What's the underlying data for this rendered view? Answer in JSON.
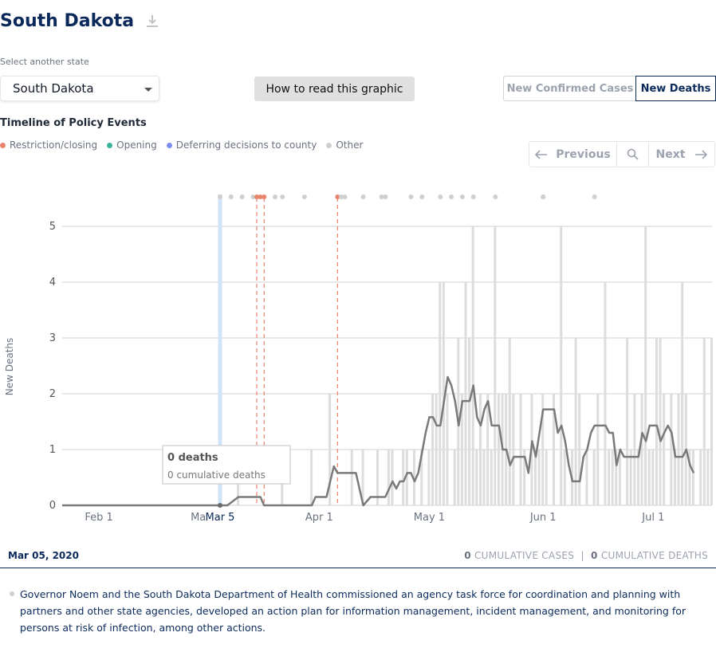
{
  "header": {
    "title": "South Dakota",
    "download_icon": "download-icon"
  },
  "state_select": {
    "label": "Select another state",
    "value": "South Dakota"
  },
  "howto_button": "How to read this graphic",
  "toggle": {
    "confirmed": "New Confirmed Cases",
    "deaths": "New Deaths",
    "active": "deaths"
  },
  "timeline": {
    "title": "Timeline of Policy Events",
    "legend": [
      {
        "label": "Restriction/closing",
        "color": "#e9836c"
      },
      {
        "label": "Opening",
        "color": "#3bb39a"
      },
      {
        "label": "Deferring decisions to county",
        "color": "#7c8ff0"
      },
      {
        "label": "Other",
        "color": "#cfcfcf"
      }
    ]
  },
  "nav": {
    "previous": "Previous",
    "next": "Next"
  },
  "chart_data": {
    "type": "bar",
    "ylabel": "New Deaths",
    "ylim": [
      0,
      5.5
    ],
    "yticks": [
      0,
      1,
      2,
      3,
      4,
      5
    ],
    "x_start": "2020-01-22",
    "x_end": "2020-07-17",
    "xticks": [
      "Feb 1",
      "Mar 1",
      "Apr 1",
      "May 1",
      "Jun 1",
      "Jul 1"
    ],
    "selected_date_label": "Mar 5",
    "bars": [
      {
        "date": "2020-03-10",
        "value": 0.5
      },
      {
        "date": "2020-03-22",
        "value": 1
      },
      {
        "date": "2020-03-30",
        "value": 1
      },
      {
        "date": "2020-04-04",
        "value": 2
      },
      {
        "date": "2020-04-10",
        "value": 1
      },
      {
        "date": "2020-04-13",
        "value": 1
      },
      {
        "date": "2020-04-17",
        "value": 1
      },
      {
        "date": "2020-04-20",
        "value": 1
      },
      {
        "date": "2020-04-21",
        "value": 1
      },
      {
        "date": "2020-04-24",
        "value": 1
      },
      {
        "date": "2020-04-25",
        "value": 1
      },
      {
        "date": "2020-04-27",
        "value": 1
      },
      {
        "date": "2020-04-29",
        "value": 1
      },
      {
        "date": "2020-05-01",
        "value": 1
      },
      {
        "date": "2020-05-02",
        "value": 2
      },
      {
        "date": "2020-05-03",
        "value": 2
      },
      {
        "date": "2020-05-04",
        "value": 4
      },
      {
        "date": "2020-05-05",
        "value": 4
      },
      {
        "date": "2020-05-06",
        "value": 2
      },
      {
        "date": "2020-05-08",
        "value": 1
      },
      {
        "date": "2020-05-09",
        "value": 3
      },
      {
        "date": "2020-05-10",
        "value": 2
      },
      {
        "date": "2020-05-11",
        "value": 4
      },
      {
        "date": "2020-05-12",
        "value": 3
      },
      {
        "date": "2020-05-13",
        "value": 5
      },
      {
        "date": "2020-05-14",
        "value": 1
      },
      {
        "date": "2020-05-15",
        "value": 2
      },
      {
        "date": "2020-05-16",
        "value": 1
      },
      {
        "date": "2020-05-17",
        "value": 2
      },
      {
        "date": "2020-05-18",
        "value": 1
      },
      {
        "date": "2020-05-19",
        "value": 5
      },
      {
        "date": "2020-05-20",
        "value": 2
      },
      {
        "date": "2020-05-21",
        "value": 2
      },
      {
        "date": "2020-05-22",
        "value": 2
      },
      {
        "date": "2020-05-23",
        "value": 3
      },
      {
        "date": "2020-05-24",
        "value": 2
      },
      {
        "date": "2020-05-26",
        "value": 2
      },
      {
        "date": "2020-05-27",
        "value": 1
      },
      {
        "date": "2020-05-29",
        "value": 2
      },
      {
        "date": "2020-05-30",
        "value": 1
      },
      {
        "date": "2020-05-31",
        "value": 1
      },
      {
        "date": "2020-06-01",
        "value": 2
      },
      {
        "date": "2020-06-02",
        "value": 1
      },
      {
        "date": "2020-06-04",
        "value": 2
      },
      {
        "date": "2020-06-06",
        "value": 5
      },
      {
        "date": "2020-06-07",
        "value": 1
      },
      {
        "date": "2020-06-09",
        "value": 1
      },
      {
        "date": "2020-06-10",
        "value": 3
      },
      {
        "date": "2020-06-11",
        "value": 2
      },
      {
        "date": "2020-06-13",
        "value": 1
      },
      {
        "date": "2020-06-15",
        "value": 1
      },
      {
        "date": "2020-06-16",
        "value": 2
      },
      {
        "date": "2020-06-18",
        "value": 4
      },
      {
        "date": "2020-06-19",
        "value": 1
      },
      {
        "date": "2020-06-20",
        "value": 1
      },
      {
        "date": "2020-06-21",
        "value": 1
      },
      {
        "date": "2020-06-22",
        "value": 1
      },
      {
        "date": "2020-06-24",
        "value": 3
      },
      {
        "date": "2020-06-25",
        "value": 1
      },
      {
        "date": "2020-06-26",
        "value": 2
      },
      {
        "date": "2020-06-27",
        "value": 1
      },
      {
        "date": "2020-06-28",
        "value": 2
      },
      {
        "date": "2020-06-29",
        "value": 5
      },
      {
        "date": "2020-06-30",
        "value": 1
      },
      {
        "date": "2020-07-01",
        "value": 1
      },
      {
        "date": "2020-07-02",
        "value": 3
      },
      {
        "date": "2020-07-03",
        "value": 3
      },
      {
        "date": "2020-07-04",
        "value": 2
      },
      {
        "date": "2020-07-06",
        "value": 2
      },
      {
        "date": "2020-07-07",
        "value": 1
      },
      {
        "date": "2020-07-08",
        "value": 2
      },
      {
        "date": "2020-07-09",
        "value": 4
      },
      {
        "date": "2020-07-10",
        "value": 2
      },
      {
        "date": "2020-07-11",
        "value": 1
      },
      {
        "date": "2020-07-12",
        "value": 1
      },
      {
        "date": "2020-07-14",
        "value": 1
      },
      {
        "date": "2020-07-15",
        "value": 3
      },
      {
        "date": "2020-07-16",
        "value": 1
      },
      {
        "date": "2020-07-17",
        "value": 3
      }
    ],
    "rolling_average": [
      {
        "date": "2020-01-22",
        "value": 0
      },
      {
        "date": "2020-03-07",
        "value": 0
      },
      {
        "date": "2020-03-10",
        "value": 0.15
      },
      {
        "date": "2020-03-16",
        "value": 0.15
      },
      {
        "date": "2020-03-17",
        "value": 0
      },
      {
        "date": "2020-03-30",
        "value": 0
      },
      {
        "date": "2020-03-31",
        "value": 0.15
      },
      {
        "date": "2020-04-03",
        "value": 0.15
      },
      {
        "date": "2020-04-05",
        "value": 0.7
      },
      {
        "date": "2020-04-06",
        "value": 0.58
      },
      {
        "date": "2020-04-11",
        "value": 0.58
      },
      {
        "date": "2020-04-13",
        "value": 0
      },
      {
        "date": "2020-04-15",
        "value": 0.15
      },
      {
        "date": "2020-04-19",
        "value": 0.15
      },
      {
        "date": "2020-04-21",
        "value": 0.43
      },
      {
        "date": "2020-04-22",
        "value": 0.3
      },
      {
        "date": "2020-04-23",
        "value": 0.43
      },
      {
        "date": "2020-04-24",
        "value": 0.43
      },
      {
        "date": "2020-04-25",
        "value": 0.58
      },
      {
        "date": "2020-04-26",
        "value": 0.58
      },
      {
        "date": "2020-04-27",
        "value": 0.43
      },
      {
        "date": "2020-04-28",
        "value": 0.58
      },
      {
        "date": "2020-04-30",
        "value": 1.3
      },
      {
        "date": "2020-05-01",
        "value": 1.58
      },
      {
        "date": "2020-05-02",
        "value": 1.58
      },
      {
        "date": "2020-05-03",
        "value": 1.43
      },
      {
        "date": "2020-05-04",
        "value": 1.43
      },
      {
        "date": "2020-05-05",
        "value": 1.87
      },
      {
        "date": "2020-05-06",
        "value": 2.3
      },
      {
        "date": "2020-05-07",
        "value": 2.15
      },
      {
        "date": "2020-05-08",
        "value": 1.87
      },
      {
        "date": "2020-05-09",
        "value": 1.43
      },
      {
        "date": "2020-05-10",
        "value": 1.87
      },
      {
        "date": "2020-05-12",
        "value": 1.87
      },
      {
        "date": "2020-05-13",
        "value": 2.15
      },
      {
        "date": "2020-05-14",
        "value": 1.58
      },
      {
        "date": "2020-05-15",
        "value": 1.43
      },
      {
        "date": "2020-05-16",
        "value": 1.72
      },
      {
        "date": "2020-05-17",
        "value": 1.87
      },
      {
        "date": "2020-05-18",
        "value": 1.43
      },
      {
        "date": "2020-05-20",
        "value": 1.43
      },
      {
        "date": "2020-05-21",
        "value": 1.0
      },
      {
        "date": "2020-05-22",
        "value": 1.0
      },
      {
        "date": "2020-05-23",
        "value": 0.72
      },
      {
        "date": "2020-05-24",
        "value": 0.87
      },
      {
        "date": "2020-05-27",
        "value": 0.87
      },
      {
        "date": "2020-05-28",
        "value": 0.58
      },
      {
        "date": "2020-05-29",
        "value": 1.15
      },
      {
        "date": "2020-05-30",
        "value": 0.87
      },
      {
        "date": "2020-05-31",
        "value": 1.3
      },
      {
        "date": "2020-06-01",
        "value": 1.72
      },
      {
        "date": "2020-06-04",
        "value": 1.72
      },
      {
        "date": "2020-06-05",
        "value": 1.3
      },
      {
        "date": "2020-06-06",
        "value": 1.43
      },
      {
        "date": "2020-06-07",
        "value": 1.15
      },
      {
        "date": "2020-06-08",
        "value": 0.72
      },
      {
        "date": "2020-06-09",
        "value": 0.43
      },
      {
        "date": "2020-06-11",
        "value": 0.43
      },
      {
        "date": "2020-06-12",
        "value": 0.87
      },
      {
        "date": "2020-06-13",
        "value": 1.0
      },
      {
        "date": "2020-06-14",
        "value": 1.3
      },
      {
        "date": "2020-06-15",
        "value": 1.43
      },
      {
        "date": "2020-06-18",
        "value": 1.43
      },
      {
        "date": "2020-06-19",
        "value": 1.3
      },
      {
        "date": "2020-06-20",
        "value": 1.3
      },
      {
        "date": "2020-06-21",
        "value": 0.72
      },
      {
        "date": "2020-06-22",
        "value": 1.0
      },
      {
        "date": "2020-06-23",
        "value": 0.87
      },
      {
        "date": "2020-06-27",
        "value": 0.87
      },
      {
        "date": "2020-06-28",
        "value": 1.3
      },
      {
        "date": "2020-06-29",
        "value": 1.15
      },
      {
        "date": "2020-06-30",
        "value": 1.43
      },
      {
        "date": "2020-07-02",
        "value": 1.43
      },
      {
        "date": "2020-07-03",
        "value": 1.15
      },
      {
        "date": "2020-07-04",
        "value": 1.3
      },
      {
        "date": "2020-07-05",
        "value": 1.43
      },
      {
        "date": "2020-07-06",
        "value": 1.3
      },
      {
        "date": "2020-07-07",
        "value": 0.87
      },
      {
        "date": "2020-07-09",
        "value": 0.87
      },
      {
        "date": "2020-07-10",
        "value": 1.0
      },
      {
        "date": "2020-07-11",
        "value": 0.72
      },
      {
        "date": "2020-07-12",
        "value": 0.58
      }
    ],
    "policy_events": [
      {
        "date": "2020-03-05",
        "type": "Other",
        "selected": true
      },
      {
        "date": "2020-03-08",
        "type": "Other"
      },
      {
        "date": "2020-03-11",
        "type": "Other"
      },
      {
        "date": "2020-03-14",
        "type": "Other"
      },
      {
        "date": "2020-03-15",
        "type": "Restriction/closing",
        "line": true
      },
      {
        "date": "2020-03-16",
        "type": "Restriction/closing"
      },
      {
        "date": "2020-03-17",
        "type": "Restriction/closing",
        "line": true
      },
      {
        "date": "2020-03-20",
        "type": "Other"
      },
      {
        "date": "2020-03-22",
        "type": "Other"
      },
      {
        "date": "2020-03-28",
        "type": "Other"
      },
      {
        "date": "2020-04-06",
        "type": "Restriction/closing",
        "line": true
      },
      {
        "date": "2020-04-07",
        "type": "Other"
      },
      {
        "date": "2020-04-08",
        "type": "Other"
      },
      {
        "date": "2020-04-13",
        "type": "Other"
      },
      {
        "date": "2020-04-18",
        "type": "Other"
      },
      {
        "date": "2020-04-19",
        "type": "Other"
      },
      {
        "date": "2020-04-26",
        "type": "Other"
      },
      {
        "date": "2020-04-29",
        "type": "Other"
      },
      {
        "date": "2020-05-04",
        "type": "Other"
      },
      {
        "date": "2020-05-07",
        "type": "Other"
      },
      {
        "date": "2020-05-10",
        "type": "Other"
      },
      {
        "date": "2020-05-13",
        "type": "Other"
      },
      {
        "date": "2020-05-19",
        "type": "Other"
      },
      {
        "date": "2020-06-01",
        "type": "Other"
      },
      {
        "date": "2020-06-01",
        "type": "Other"
      },
      {
        "date": "2020-06-15",
        "type": "Other"
      }
    ],
    "tooltip": {
      "title": "0 deaths",
      "subtitle": "0 cumulative deaths"
    },
    "colors": {
      "bars": "#dddddd",
      "line": "#7a7a7a",
      "grid": "#d9d9d9",
      "selected": "#cfe4f7",
      "restriction": "#e9836c",
      "other": "#cfcfcf"
    }
  },
  "footer": {
    "date": "Mar 05, 2020",
    "cases_value": "0",
    "cases_label": "CUMULATIVE CASES",
    "separator": "|",
    "deaths_value": "0",
    "deaths_label": "CUMULATIVE DEATHS"
  },
  "event_text": "Governor Noem and the South Dakota Department of Health commissioned an agency task force for coordination and planning with partners and other state agencies, developed an action plan for information management, incident management, and monitoring for persons at risk of infection, among other actions."
}
